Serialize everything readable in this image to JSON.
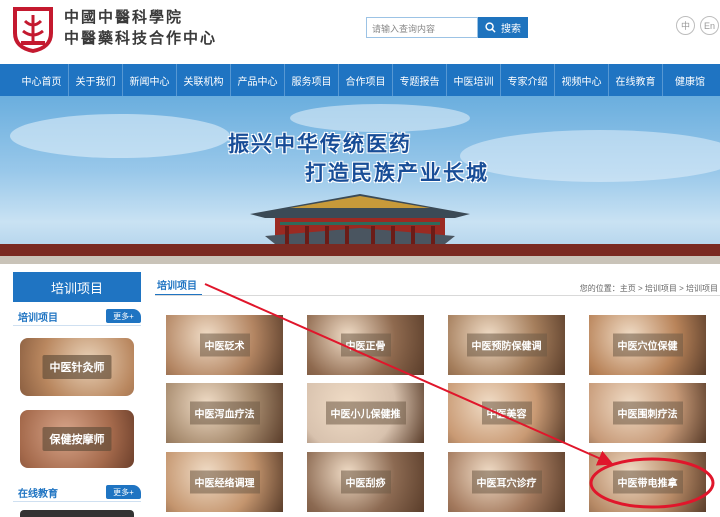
{
  "header": {
    "org_name_1": "中國中醫科學院",
    "org_name_2": "中醫藥科技合作中心",
    "search_placeholder": "请输入查询内容",
    "search_button": "搜索",
    "lang_zh": "中",
    "lang_en": "En"
  },
  "nav": [
    {
      "label": "中心首页"
    },
    {
      "label": "关于我们"
    },
    {
      "label": "新闻中心"
    },
    {
      "label": "关联机构"
    },
    {
      "label": "产品中心"
    },
    {
      "label": "服务项目"
    },
    {
      "label": "合作项目"
    },
    {
      "label": "专题报告"
    },
    {
      "label": "中医培训"
    },
    {
      "label": "专家介绍"
    },
    {
      "label": "视频中心"
    },
    {
      "label": "在线教育"
    },
    {
      "label": "健康馆"
    }
  ],
  "banner": {
    "line1": "振兴中华传统医药",
    "line2": "打造民族产业长城"
  },
  "sidebar": {
    "title": "培训项目",
    "section1": "培训项目",
    "section2": "在线教育",
    "more": "更多+",
    "items": [
      {
        "label": "中医针灸师"
      },
      {
        "label": "保健按摩师"
      }
    ]
  },
  "main": {
    "tab": "培训项目",
    "breadcrumb": "您的位置：主页 > 培训项目 > 培训项目",
    "tiles": [
      {
        "label": "中医砭术",
        "color": "#b38562"
      },
      {
        "label": "中医正骨",
        "color": "#8f6a4f"
      },
      {
        "label": "中医预防保健调",
        "color": "#a57e5c"
      },
      {
        "label": "中医穴位保健",
        "color": "#b9845a"
      },
      {
        "label": "中医泻血疗法",
        "color": "#a68a6d"
      },
      {
        "label": "中医小儿保健推",
        "color": "#d8c2ae"
      },
      {
        "label": "中医美容",
        "color": "#c99a74"
      },
      {
        "label": "中医围刺疗法",
        "color": "#c79a78"
      },
      {
        "label": "中医经络调理",
        "color": "#c4956e"
      },
      {
        "label": "中医刮痧",
        "color": "#8c6a52"
      },
      {
        "label": "中医耳穴诊疗",
        "color": "#a47a5e"
      },
      {
        "label": "中医带电推拿",
        "color": "#b88b67"
      }
    ]
  },
  "colors": {
    "brand_blue": "#1f74c2",
    "annotation_red": "#e0162b"
  }
}
